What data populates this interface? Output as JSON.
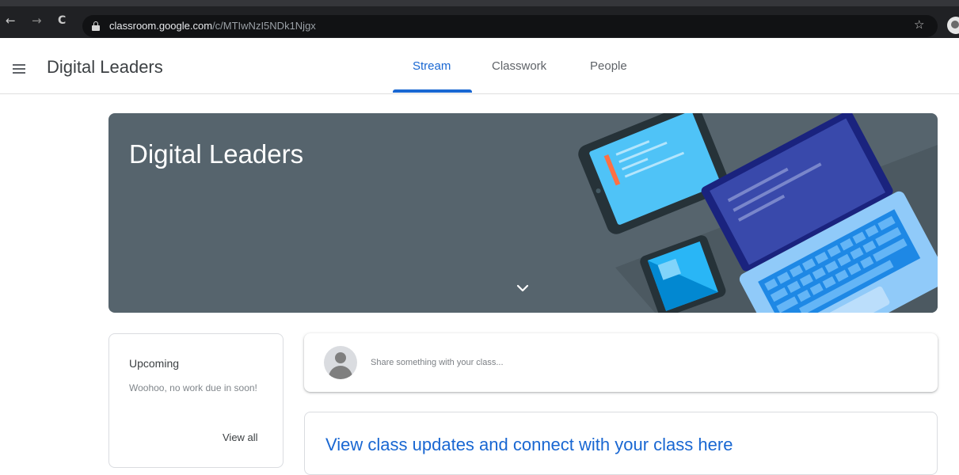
{
  "browser": {
    "url_host": "classroom.google.com",
    "url_path": "/c/MTIwNzI5NDk1Njgx",
    "back_glyph": "←",
    "forward_glyph": "→",
    "reload_glyph": "C",
    "star_glyph": "☆"
  },
  "header": {
    "class_title": "Digital Leaders",
    "tabs": [
      {
        "label": "Stream",
        "active": true
      },
      {
        "label": "Classwork",
        "active": false
      },
      {
        "label": "People",
        "active": false
      }
    ]
  },
  "banner": {
    "title": "Digital Leaders",
    "background_color": "#56646d"
  },
  "upcoming": {
    "title": "Upcoming",
    "text": "Woohoo, no work due in soon!",
    "view_all_label": "View all"
  },
  "share": {
    "placeholder": "Share something with your class..."
  },
  "stream": {
    "heading": "View class updates and connect with your class here"
  },
  "colors": {
    "accent": "#1967d2",
    "chrome_dark": "#202124"
  },
  "icons": {
    "menu": "hamburger-menu-icon",
    "lock": "lock-icon",
    "star": "bookmark-star-icon",
    "chevron": "chevron-down-icon",
    "avatar": "default-avatar-icon"
  }
}
